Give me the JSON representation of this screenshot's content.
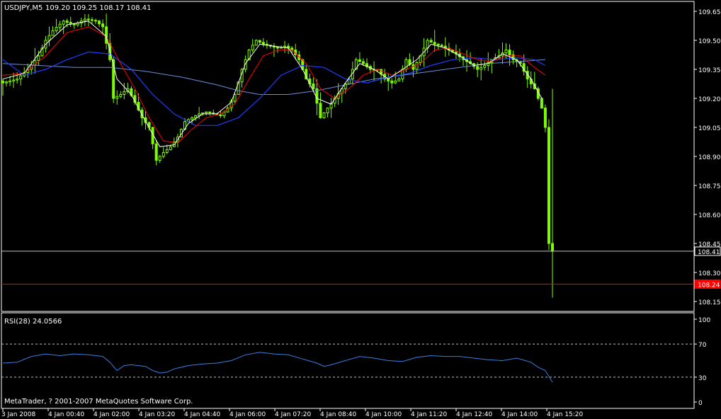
{
  "header": {
    "symbol": "USDJPY,M5",
    "ohlc": "109.20 109.25 108.17 108.41"
  },
  "rsi_header": {
    "label": "RSI(28) 24.0566"
  },
  "copyright": "MetaTrader, ? 2001-2007 MetaQuotes Software Corp.",
  "colors": {
    "background": "#000000",
    "frame": "#ffffff",
    "candles": "#7cfc00",
    "ma_fast": "#ffffff",
    "ma_mid": "#ff0000",
    "ma_slow": "#1e3cff",
    "ma_long": "#6b8fd8",
    "rsi_line": "#3a7fe0",
    "bid_line": "#c0c0c0",
    "ask_line": "#ff0000"
  },
  "chart_data": [
    {
      "type": "line",
      "name": "price-panel",
      "ylim": [
        108.1,
        109.7
      ],
      "y_ticks": [
        "109.65",
        "109.50",
        "109.35",
        "109.20",
        "109.05",
        "108.90",
        "108.75",
        "108.60",
        "108.45",
        "108.30",
        "108.15"
      ],
      "x_ticks": [
        "3 Jan 2008",
        "4 Jan 00:40",
        "4 Jan 02:00",
        "4 Jan 03:20",
        "4 Jan 04:40",
        "4 Jan 06:00",
        "4 Jan 07:20",
        "4 Jan 08:40",
        "4 Jan 10:00",
        "4 Jan 11:20",
        "4 Jan 12:40",
        "4 Jan 14:00",
        "4 Jan 15:20"
      ],
      "bid_line": {
        "value": 108.41,
        "label": "108.41"
      },
      "ask_line": {
        "value": 108.24,
        "label": "108.24"
      },
      "close_path": [
        [
          0,
          109.28
        ],
        [
          4,
          109.3
        ],
        [
          7,
          109.35
        ],
        [
          10,
          109.42
        ],
        [
          12,
          109.5
        ],
        [
          14,
          109.55
        ],
        [
          17,
          109.6
        ],
        [
          20,
          109.58
        ],
        [
          23,
          109.61
        ],
        [
          26,
          109.6
        ],
        [
          28,
          109.57
        ],
        [
          30,
          109.4
        ],
        [
          31,
          109.2
        ],
        [
          33,
          109.22
        ],
        [
          35,
          109.25
        ],
        [
          37,
          109.18
        ],
        [
          39,
          109.1
        ],
        [
          41,
          109.05
        ],
        [
          43,
          108.88
        ],
        [
          45,
          108.92
        ],
        [
          47,
          108.95
        ],
        [
          49,
          109.0
        ],
        [
          51,
          109.08
        ],
        [
          53,
          109.1
        ],
        [
          55,
          109.12
        ],
        [
          57,
          109.13
        ],
        [
          59,
          109.12
        ],
        [
          61,
          109.11
        ],
        [
          63,
          109.15
        ],
        [
          65,
          109.22
        ],
        [
          67,
          109.35
        ],
        [
          69,
          109.45
        ],
        [
          71,
          109.5
        ],
        [
          73,
          109.48
        ],
        [
          75,
          109.47
        ],
        [
          77,
          109.46
        ],
        [
          79,
          109.47
        ],
        [
          81,
          109.45
        ],
        [
          83,
          109.4
        ],
        [
          85,
          109.3
        ],
        [
          87,
          109.25
        ],
        [
          89,
          109.1
        ],
        [
          91,
          109.15
        ],
        [
          93,
          109.2
        ],
        [
          95,
          109.25
        ],
        [
          97,
          109.3
        ],
        [
          99,
          109.4
        ],
        [
          101,
          109.38
        ],
        [
          103,
          109.35
        ],
        [
          105,
          109.35
        ],
        [
          107,
          109.3
        ],
        [
          109,
          109.28
        ],
        [
          111,
          109.3
        ],
        [
          113,
          109.4
        ],
        [
          115,
          109.35
        ],
        [
          117,
          109.42
        ],
        [
          119,
          109.5
        ],
        [
          121,
          109.48
        ],
        [
          123,
          109.47
        ],
        [
          125,
          109.45
        ],
        [
          127,
          109.43
        ],
        [
          129,
          109.4
        ],
        [
          131,
          109.38
        ],
        [
          133,
          109.35
        ],
        [
          135,
          109.37
        ],
        [
          137,
          109.4
        ],
        [
          139,
          109.42
        ],
        [
          141,
          109.45
        ],
        [
          143,
          109.4
        ],
        [
          145,
          109.38
        ],
        [
          147,
          109.3
        ],
        [
          149,
          109.25
        ],
        [
          151,
          109.15
        ],
        [
          152,
          109.05
        ],
        [
          153,
          108.45
        ],
        [
          154,
          108.41
        ]
      ],
      "ma_fast_path": [
        [
          0,
          109.3
        ],
        [
          6,
          109.33
        ],
        [
          12,
          109.48
        ],
        [
          18,
          109.58
        ],
        [
          24,
          109.6
        ],
        [
          29,
          109.52
        ],
        [
          32,
          109.3
        ],
        [
          36,
          109.22
        ],
        [
          40,
          109.08
        ],
        [
          44,
          108.95
        ],
        [
          48,
          108.96
        ],
        [
          52,
          109.07
        ],
        [
          56,
          109.12
        ],
        [
          60,
          109.12
        ],
        [
          64,
          109.18
        ],
        [
          68,
          109.38
        ],
        [
          72,
          109.48
        ],
        [
          76,
          109.47
        ],
        [
          80,
          109.46
        ],
        [
          84,
          109.35
        ],
        [
          88,
          109.2
        ],
        [
          92,
          109.17
        ],
        [
          96,
          109.28
        ],
        [
          100,
          109.38
        ],
        [
          104,
          109.35
        ],
        [
          108,
          109.3
        ],
        [
          112,
          109.35
        ],
        [
          116,
          109.4
        ],
        [
          120,
          109.48
        ],
        [
          124,
          109.46
        ],
        [
          128,
          109.42
        ],
        [
          132,
          109.37
        ],
        [
          136,
          109.38
        ],
        [
          140,
          109.43
        ],
        [
          144,
          109.4
        ],
        [
          148,
          109.3
        ],
        [
          151,
          109.2
        ]
      ],
      "ma_mid_path": [
        [
          0,
          109.32
        ],
        [
          6,
          109.33
        ],
        [
          12,
          109.42
        ],
        [
          18,
          109.54
        ],
        [
          24,
          109.57
        ],
        [
          29,
          109.52
        ],
        [
          33,
          109.38
        ],
        [
          37,
          109.25
        ],
        [
          41,
          109.1
        ],
        [
          45,
          108.98
        ],
        [
          49,
          108.97
        ],
        [
          53,
          109.04
        ],
        [
          57,
          109.1
        ],
        [
          61,
          109.12
        ],
        [
          65,
          109.17
        ],
        [
          69,
          109.3
        ],
        [
          73,
          109.42
        ],
        [
          77,
          109.45
        ],
        [
          81,
          109.45
        ],
        [
          85,
          109.38
        ],
        [
          89,
          109.25
        ],
        [
          93,
          109.2
        ],
        [
          97,
          109.25
        ],
        [
          101,
          109.32
        ],
        [
          105,
          109.35
        ],
        [
          109,
          109.32
        ],
        [
          113,
          109.35
        ],
        [
          117,
          109.38
        ],
        [
          121,
          109.45
        ],
        [
          125,
          109.46
        ],
        [
          129,
          109.43
        ],
        [
          133,
          109.4
        ],
        [
          137,
          109.39
        ],
        [
          141,
          109.42
        ],
        [
          145,
          109.42
        ],
        [
          149,
          109.36
        ],
        [
          152,
          109.32
        ]
      ],
      "ma_slow_path": [
        [
          0,
          109.4
        ],
        [
          6,
          109.32
        ],
        [
          12,
          109.35
        ],
        [
          18,
          109.4
        ],
        [
          24,
          109.44
        ],
        [
          30,
          109.43
        ],
        [
          36,
          109.35
        ],
        [
          42,
          109.22
        ],
        [
          48,
          109.12
        ],
        [
          54,
          109.06
        ],
        [
          60,
          109.06
        ],
        [
          66,
          109.1
        ],
        [
          72,
          109.2
        ],
        [
          78,
          109.32
        ],
        [
          84,
          109.37
        ],
        [
          90,
          109.36
        ],
        [
          96,
          109.3
        ],
        [
          102,
          109.28
        ],
        [
          108,
          109.31
        ],
        [
          114,
          109.33
        ],
        [
          120,
          109.37
        ],
        [
          126,
          109.4
        ],
        [
          132,
          109.41
        ],
        [
          138,
          109.4
        ],
        [
          144,
          109.41
        ],
        [
          149,
          109.4
        ],
        [
          152,
          109.37
        ]
      ],
      "ma_long_path": [
        [
          0,
          109.38
        ],
        [
          10,
          109.37
        ],
        [
          20,
          109.36
        ],
        [
          30,
          109.36
        ],
        [
          40,
          109.34
        ],
        [
          50,
          109.31
        ],
        [
          60,
          109.27
        ],
        [
          66,
          109.24
        ],
        [
          72,
          109.22
        ],
        [
          80,
          109.22
        ],
        [
          88,
          109.24
        ],
        [
          96,
          109.27
        ],
        [
          104,
          109.3
        ],
        [
          112,
          109.32
        ],
        [
          120,
          109.34
        ],
        [
          128,
          109.36
        ],
        [
          136,
          109.38
        ],
        [
          144,
          109.39
        ],
        [
          152,
          109.4
        ]
      ]
    },
    {
      "type": "line",
      "name": "rsi-panel",
      "ylim": [
        0,
        100
      ],
      "y_ticks": [
        "100",
        "70",
        "30",
        "0"
      ],
      "levels": [
        70,
        30
      ],
      "path": [
        [
          0,
          47
        ],
        [
          4,
          48
        ],
        [
          8,
          55
        ],
        [
          12,
          58
        ],
        [
          16,
          56
        ],
        [
          20,
          58
        ],
        [
          24,
          57
        ],
        [
          28,
          55
        ],
        [
          30,
          48
        ],
        [
          32,
          38
        ],
        [
          34,
          44
        ],
        [
          36,
          45
        ],
        [
          40,
          43
        ],
        [
          42,
          38
        ],
        [
          44,
          35
        ],
        [
          46,
          36
        ],
        [
          48,
          40
        ],
        [
          52,
          44
        ],
        [
          56,
          46
        ],
        [
          60,
          47
        ],
        [
          64,
          50
        ],
        [
          68,
          57
        ],
        [
          72,
          60
        ],
        [
          76,
          58
        ],
        [
          80,
          57
        ],
        [
          84,
          52
        ],
        [
          88,
          47
        ],
        [
          90,
          43
        ],
        [
          92,
          45
        ],
        [
          96,
          50
        ],
        [
          100,
          55
        ],
        [
          104,
          53
        ],
        [
          108,
          50
        ],
        [
          112,
          49
        ],
        [
          116,
          54
        ],
        [
          120,
          56
        ],
        [
          124,
          55
        ],
        [
          128,
          55
        ],
        [
          132,
          53
        ],
        [
          136,
          51
        ],
        [
          140,
          50
        ],
        [
          144,
          53
        ],
        [
          148,
          48
        ],
        [
          150,
          42
        ],
        [
          152,
          38
        ],
        [
          154,
          24
        ]
      ]
    }
  ]
}
